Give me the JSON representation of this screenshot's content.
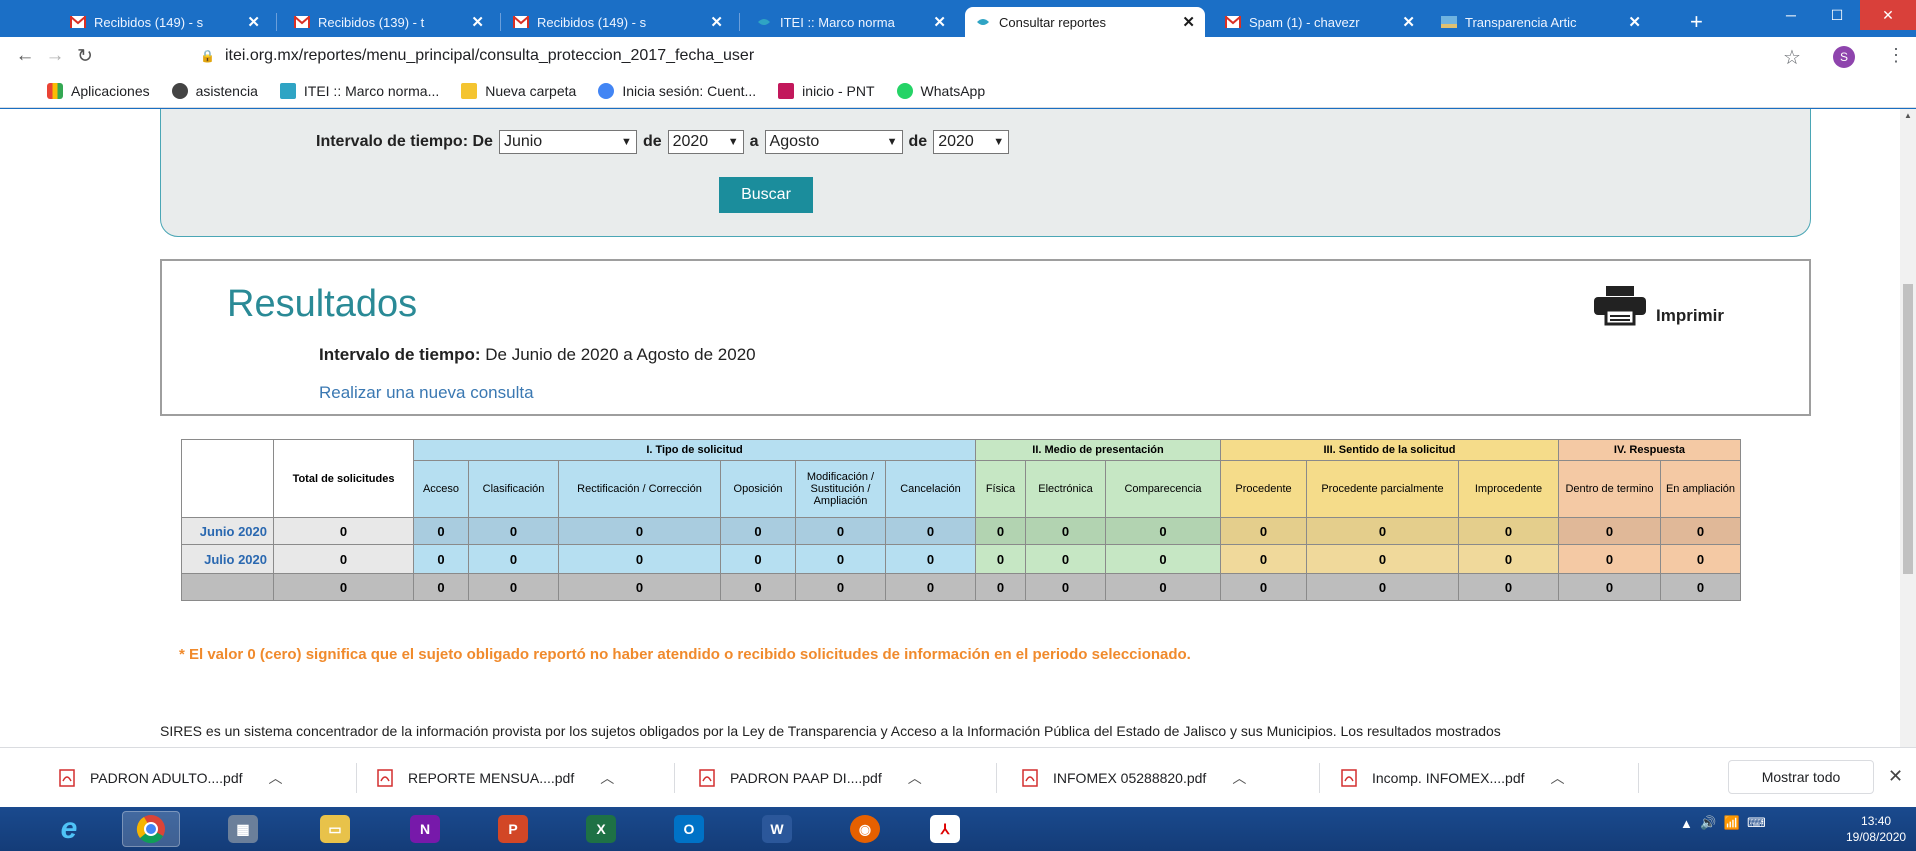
{
  "browser": {
    "tabs": [
      {
        "title": "Recibidos (149) - s",
        "icon": "gmail-icon",
        "active": false
      },
      {
        "title": "Recibidos (139) - t",
        "icon": "gmail-icon",
        "active": false
      },
      {
        "title": "Recibidos (149) - s",
        "icon": "gmail-icon",
        "active": false
      },
      {
        "title": "ITEI :: Marco norma",
        "icon": "itei-icon",
        "active": false
      },
      {
        "title": "Consultar reportes",
        "icon": "itei-icon",
        "active": true
      },
      {
        "title": "Spam (1) - chavezr",
        "icon": "gmail-icon",
        "active": false
      },
      {
        "title": "Transparencia Artic",
        "icon": "transparencia-icon",
        "active": false
      }
    ],
    "tab_close": "✕",
    "new_tab": "+",
    "url": "itei.org.mx/reportes/menu_principal/consulta_proteccion_2017_fecha_user",
    "profile_initial": "S",
    "bookmarks": [
      "Aplicaciones",
      "asistencia",
      "ITEI :: Marco norma...",
      "Nueva carpeta",
      "Inicia sesión: Cuent...",
      "inicio - PNT",
      "WhatsApp"
    ]
  },
  "filter": {
    "label": "Intervalo de tiempo:",
    "de": "De",
    "month_from": "Junio",
    "de2": "de",
    "year_from": "2020",
    "a": "a",
    "month_to": "Agosto",
    "de3": "de",
    "year_to": "2020",
    "search_button": "Buscar"
  },
  "results": {
    "title": "Resultados",
    "interval_label": "Intervalo de tiempo:",
    "interval_value": "De Junio de 2020 a Agosto de 2020",
    "new_query_link": "Realizar una nueva consulta",
    "print_label": "Imprimir"
  },
  "table": {
    "groups": [
      "I. Tipo de solicitud",
      "II. Medio de presentación",
      "III. Sentido de la solicitud",
      "IV. Respuesta"
    ],
    "total_header": "Total de solicitudes",
    "columns": [
      "Acceso",
      "Clasificación",
      "Rectificación / Corrección",
      "Oposición",
      "Modificación / Sustitución / Ampliación",
      "Cancelación",
      "Física",
      "Electrónica",
      "Comparecencia",
      "Procedente",
      "Procedente parcialmente",
      "Improcedente",
      "Dentro de termino",
      "En ampliación"
    ],
    "rows": [
      {
        "label": "Junio 2020",
        "total": "0",
        "values": [
          "0",
          "0",
          "0",
          "0",
          "0",
          "0",
          "0",
          "0",
          "0",
          "0",
          "0",
          "0",
          "0",
          "0"
        ]
      },
      {
        "label": "Julio 2020",
        "total": "0",
        "values": [
          "0",
          "0",
          "0",
          "0",
          "0",
          "0",
          "0",
          "0",
          "0",
          "0",
          "0",
          "0",
          "0",
          "0"
        ]
      },
      {
        "label": "",
        "total": "0",
        "values": [
          "0",
          "0",
          "0",
          "0",
          "0",
          "0",
          "0",
          "0",
          "0",
          "0",
          "0",
          "0",
          "0",
          "0"
        ]
      }
    ]
  },
  "note": "* El valor 0 (cero) significa que el sujeto obligado reportó no haber atendido o recibido solicitudes de información en el periodo seleccionado.",
  "footer_text": "SIRES es un sistema concentrador de la información provista por los sujetos obligados por la Ley de Transparencia y Acceso a la Información Pública del Estado de Jalisco y sus Municipios. Los resultados mostrados",
  "downloads": {
    "items": [
      "PADRON ADULTO....pdf",
      "REPORTE MENSUA....pdf",
      "PADRON PAAP DI....pdf",
      "INFOMEX 05288820.pdf",
      "Incomp. INFOMEX....pdf"
    ],
    "show_all": "Mostrar todo"
  },
  "taskbar": {
    "time": "13:40",
    "date": "19/08/2020"
  }
}
